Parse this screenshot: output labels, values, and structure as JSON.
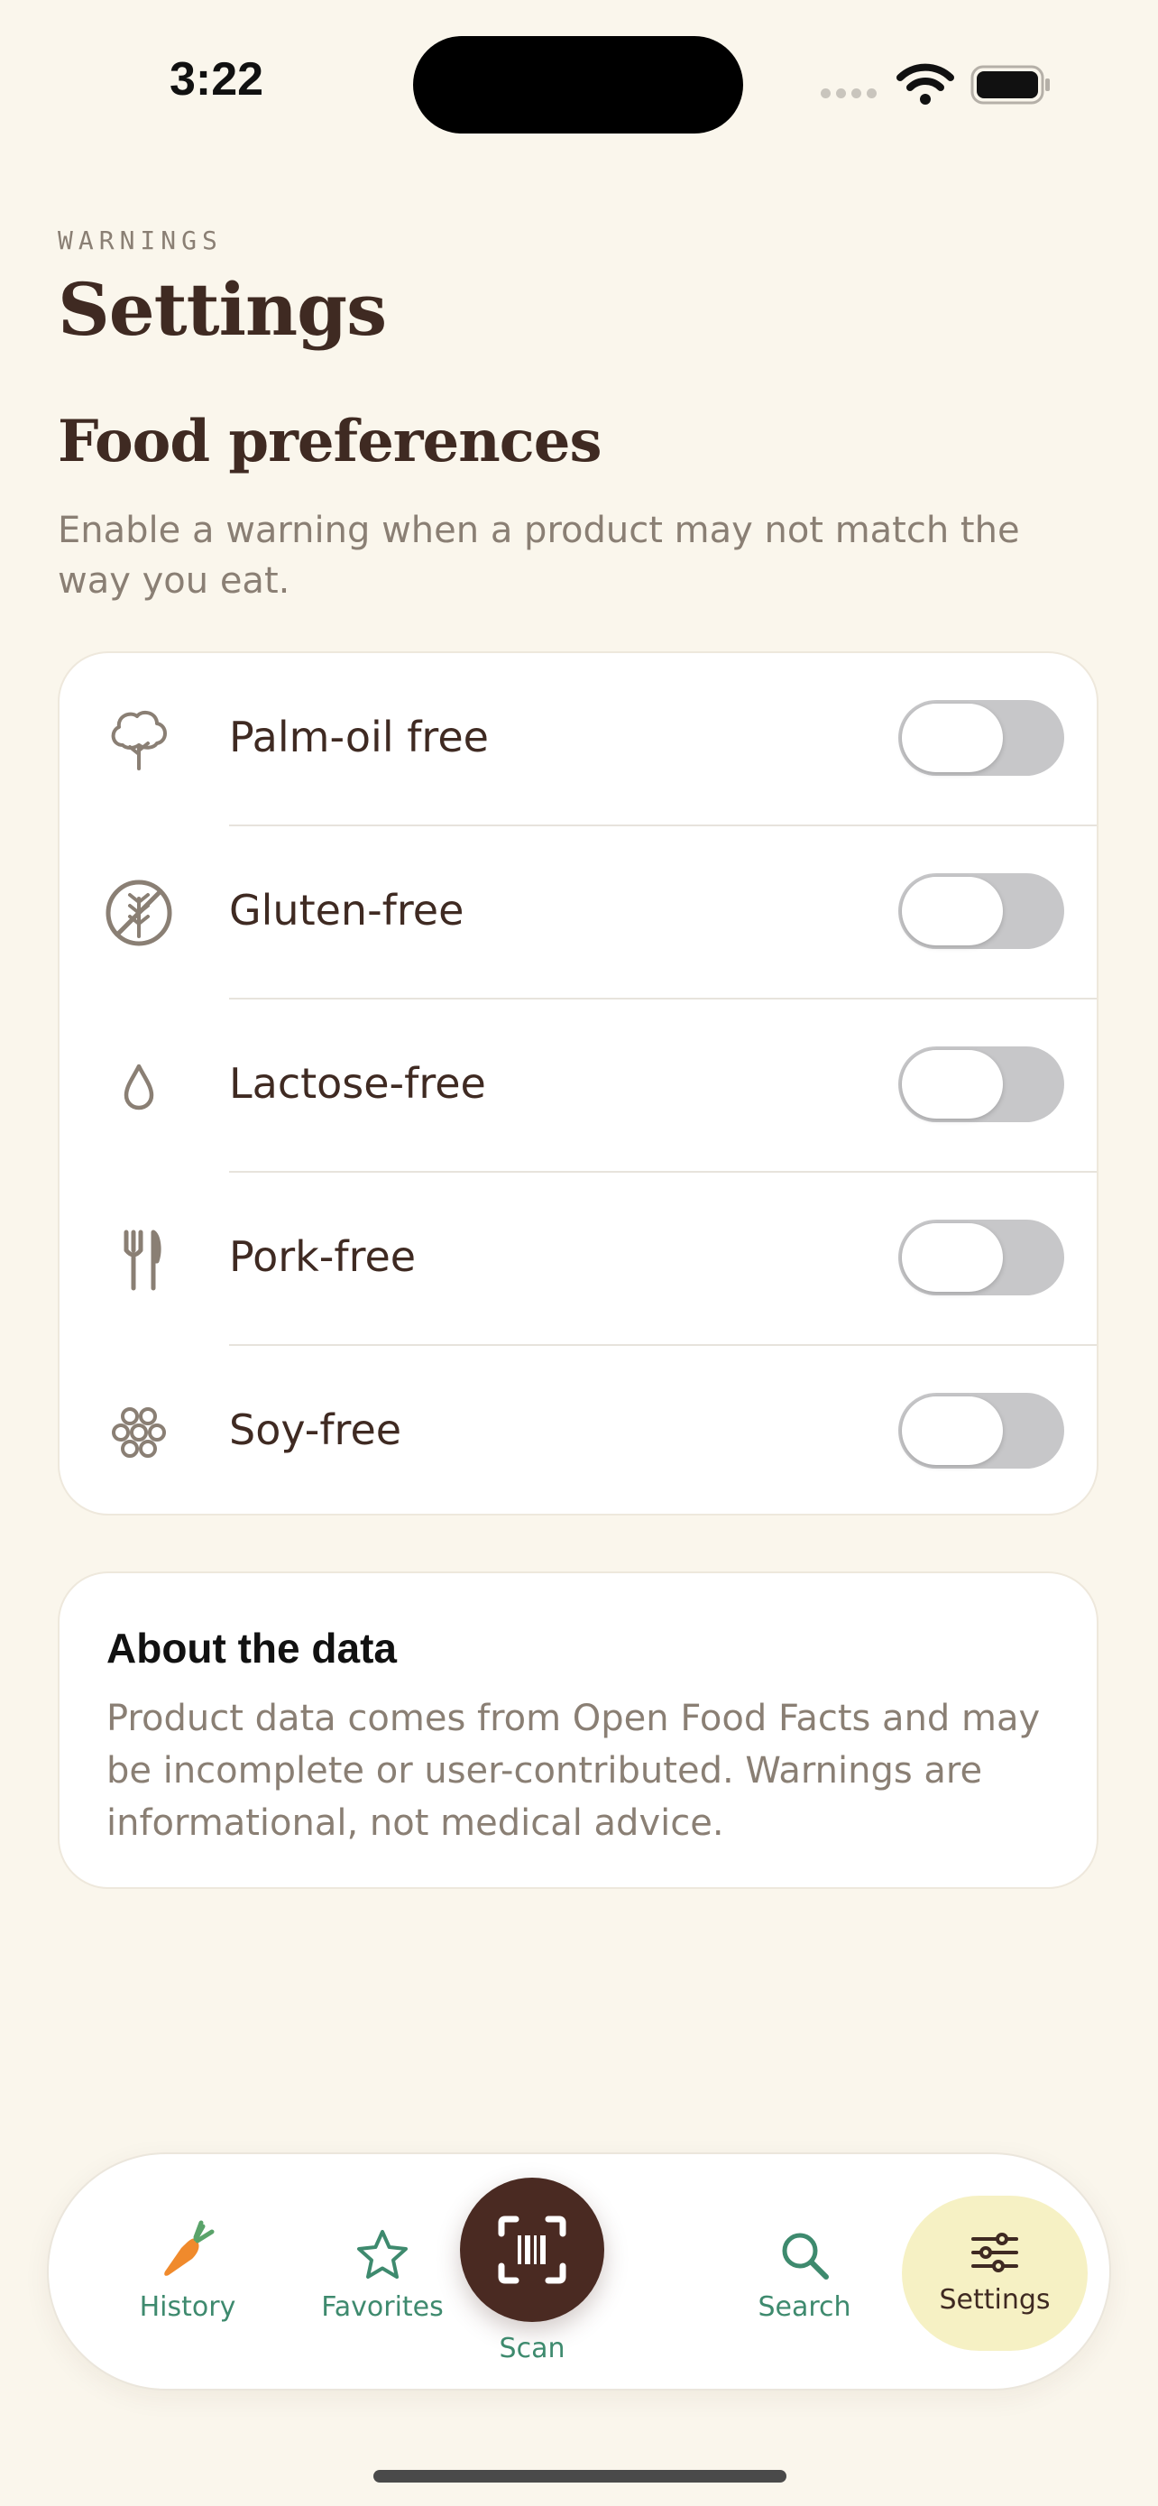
{
  "status_bar": {
    "time": "3:22"
  },
  "header": {
    "eyebrow": "WARNINGS",
    "title": "Settings"
  },
  "food_preferences": {
    "title": "Food preferences",
    "description": "Enable a warning when a product may not match the way you eat.",
    "items": [
      {
        "label": "Palm-oil free",
        "icon": "tree-icon",
        "enabled": false
      },
      {
        "label": "Gluten-free",
        "icon": "no-wheat-icon",
        "enabled": false
      },
      {
        "label": "Lactose-free",
        "icon": "drop-icon",
        "enabled": false
      },
      {
        "label": "Pork-free",
        "icon": "fork-knife-icon",
        "enabled": false
      },
      {
        "label": "Soy-free",
        "icon": "soybeans-icon",
        "enabled": false
      }
    ]
  },
  "about": {
    "title": "About the data",
    "body": "Product data comes from Open Food Facts and may be incomplete or user-contributed. Warnings are informational, not medical advice."
  },
  "tab_bar": {
    "history": "History",
    "favorites": "Favorites",
    "scan": "Scan",
    "search": "Search",
    "settings": "Settings",
    "active": "settings"
  },
  "colors": {
    "background": "#faf6ec",
    "primary_text": "#3f2a22",
    "muted_text": "#8a7f74",
    "accent_green": "#3e8a6e",
    "scan_button": "#4a2a22",
    "active_tab": "#f6f1c4",
    "toggle_off": "#c7c7c9"
  }
}
